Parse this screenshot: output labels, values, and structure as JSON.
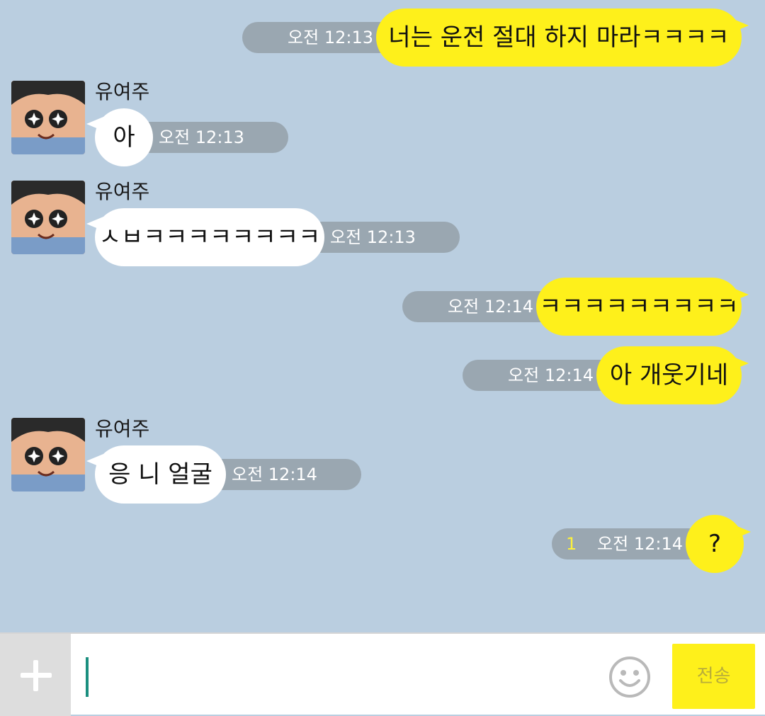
{
  "colors": {
    "background": "#bacee0",
    "my_bubble": "#fef01b",
    "their_bubble": "#ffffff",
    "timestamp_pill": "#9aa7b1",
    "unread_count": "#fdf13c",
    "send_button": "#fef01b"
  },
  "messages": [
    {
      "direction": "outgoing",
      "text": "너는 운전 절대 하지 마라ㅋㅋㅋㅋ",
      "time": "오전 12:13"
    },
    {
      "direction": "incoming",
      "sender": "유여주",
      "text": "아",
      "time": "오전 12:13"
    },
    {
      "direction": "incoming",
      "sender": "유여주",
      "text": "ㅅㅂㅋㅋㅋㅋㅋㅋㅋㅋ",
      "time": "오전 12:13"
    },
    {
      "direction": "outgoing",
      "text": "ㅋㅋㅋㅋㅋㅋㅋㅋㅋ",
      "time": "오전 12:14"
    },
    {
      "direction": "outgoing",
      "text": "아 개웃기네",
      "time": "오전 12:14"
    },
    {
      "direction": "incoming",
      "sender": "유여주",
      "text": "응 니 얼굴",
      "time": "오전 12:14"
    },
    {
      "direction": "outgoing",
      "text": "?",
      "time": "오전 12:14",
      "unread": "1"
    }
  ],
  "input_bar": {
    "attach_icon": "plus-icon",
    "input_value": "",
    "emoji_icon": "smiley-icon",
    "send_label": "전송"
  }
}
